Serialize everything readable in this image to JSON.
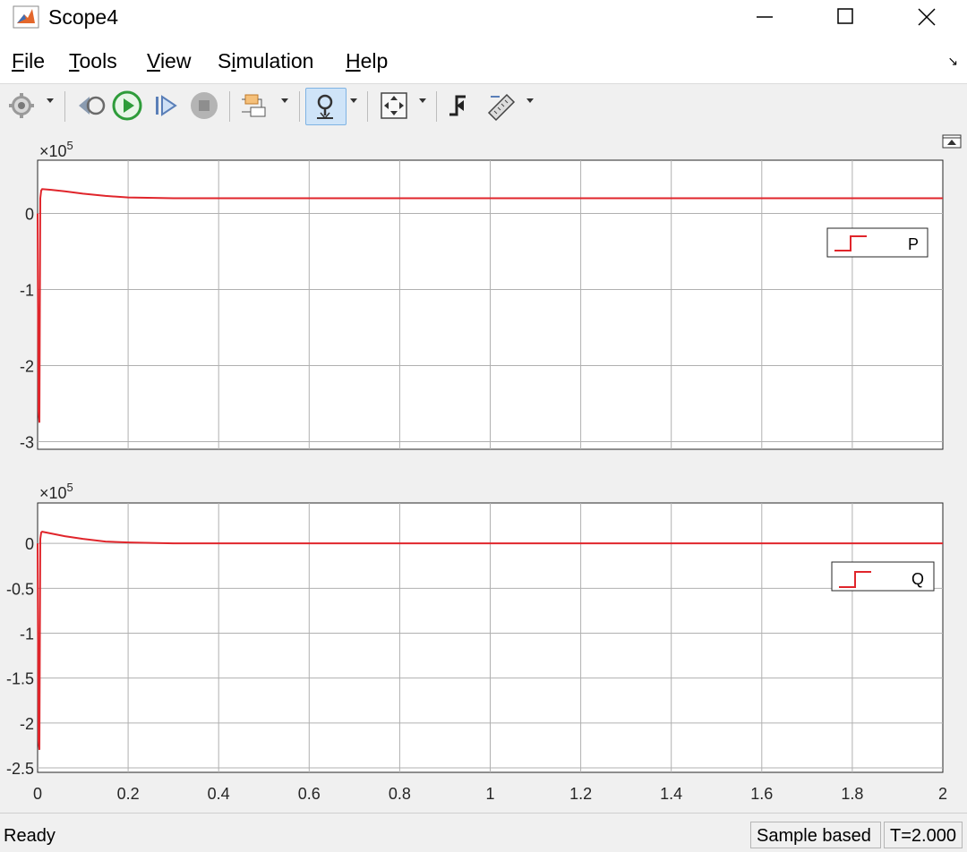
{
  "window": {
    "title": "Scope4"
  },
  "window_controls": {
    "minimize": "minimize",
    "maximize": "maximize",
    "close": "close"
  },
  "menu": {
    "file": {
      "u": "F",
      "rest": "ile"
    },
    "tools": {
      "u": "T",
      "rest": "ools"
    },
    "view": {
      "u": "V",
      "rest": "iew"
    },
    "simulation": {
      "pre": "S",
      "u": "i",
      "rest": "mulation"
    },
    "help": {
      "u": "H",
      "rest": "elp"
    }
  },
  "toolbar": {
    "icons": [
      "gear-icon",
      "step-back-icon",
      "run-icon",
      "step-forward-icon",
      "stop-icon",
      "signal-selector-icon",
      "zoom-icon",
      "autoscale-icon",
      "triggers-icon",
      "measurements-icon"
    ],
    "accent": "#2e9c3a"
  },
  "plot_colors": {
    "line": "#e0252b",
    "grid": "#b0b0b0",
    "axes": "#262626"
  },
  "chart_data": [
    {
      "type": "line",
      "exponent_label": "×10^5",
      "exponent_base": "×10",
      "exponent_power": "5",
      "xlim": [
        0,
        2
      ],
      "ylim": [
        -3.1,
        0.7
      ],
      "x_ticks": [
        "0",
        "0.2",
        "0.4",
        "0.6",
        "0.8",
        "1",
        "1.2",
        "1.4",
        "1.6",
        "1.8",
        "2"
      ],
      "y_ticks": [
        0,
        -1,
        -2,
        -3
      ],
      "y_tick_labels": [
        "0",
        "-1",
        "-2",
        "-3"
      ],
      "grid": true,
      "legend_position": "right",
      "series": [
        {
          "name": "P",
          "x": [
            0,
            0.002,
            0.004,
            0.006,
            0.008,
            0.01,
            0.03,
            0.06,
            0.1,
            0.15,
            0.2,
            0.3,
            0.4,
            0.6,
            1,
            1.5,
            2
          ],
          "y": [
            0,
            -2.6,
            -2.75,
            0.2,
            0.3,
            0.32,
            0.31,
            0.29,
            0.26,
            0.23,
            0.21,
            0.2,
            0.2,
            0.2,
            0.2,
            0.2,
            0.2
          ]
        }
      ]
    },
    {
      "type": "line",
      "exponent_label": "×10^5",
      "exponent_base": "×10",
      "exponent_power": "5",
      "xlim": [
        0,
        2
      ],
      "ylim": [
        -2.55,
        0.45
      ],
      "x_ticks": [
        "0",
        "0.2",
        "0.4",
        "0.6",
        "0.8",
        "1",
        "1.2",
        "1.4",
        "1.6",
        "1.8",
        "2"
      ],
      "y_ticks": [
        0,
        -0.5,
        -1,
        -1.5,
        -2,
        -2.5
      ],
      "y_tick_labels": [
        "0",
        "-0.5",
        "-1",
        "-1.5",
        "-2",
        "-2.5"
      ],
      "grid": true,
      "legend_position": "right",
      "series": [
        {
          "name": "Q",
          "x": [
            0,
            0.002,
            0.004,
            0.006,
            0.008,
            0.01,
            0.03,
            0.06,
            0.1,
            0.15,
            0.2,
            0.3,
            0.5,
            1,
            1.5,
            2
          ],
          "y": [
            0,
            -2.2,
            -2.3,
            0.05,
            0.12,
            0.13,
            0.11,
            0.08,
            0.05,
            0.02,
            0.01,
            0.0,
            0.0,
            0.0,
            0.0,
            0.0
          ]
        }
      ]
    }
  ],
  "status": {
    "ready": "Ready",
    "mode": "Sample based",
    "time": "T=2.000"
  }
}
